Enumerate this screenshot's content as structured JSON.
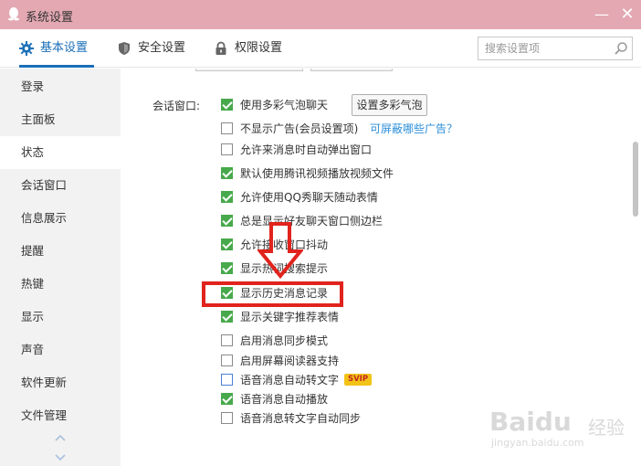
{
  "window": {
    "title": "系统设置",
    "minimize_glyph": "—",
    "close_glyph": "✕"
  },
  "tabs": [
    {
      "label": "基本设置",
      "icon": "gear-icon",
      "active": true
    },
    {
      "label": "安全设置",
      "icon": "shield-icon",
      "active": false
    },
    {
      "label": "权限设置",
      "icon": "lock-icon",
      "active": false
    }
  ],
  "search": {
    "placeholder": "搜索设置项",
    "value": ""
  },
  "sidebar": {
    "items": [
      {
        "label": "登录",
        "active": false
      },
      {
        "label": "主面板",
        "active": false
      },
      {
        "label": "状态",
        "active": true
      },
      {
        "label": "会话窗口",
        "active": false
      },
      {
        "label": "信息展示",
        "active": false
      },
      {
        "label": "提醒",
        "active": false
      },
      {
        "label": "热键",
        "active": false
      },
      {
        "label": "显示",
        "active": false
      },
      {
        "label": "声音",
        "active": false
      },
      {
        "label": "软件更新",
        "active": false
      },
      {
        "label": "文件管理",
        "active": false
      }
    ]
  },
  "main": {
    "section_label": "会话窗口:",
    "bubble_button_label": "设置多彩气泡",
    "ad_link": "可屏蔽哪些广告？",
    "svip_badge": "SVIP",
    "options": [
      {
        "label": "使用多彩气泡聊天",
        "checked": true
      },
      {
        "label": "不显示广告(会员设置项)",
        "checked": false
      },
      {
        "label": "允许来消息时自动弹出窗口",
        "checked": false
      },
      {
        "label": "默认使用腾讯视频播放视频文件",
        "checked": true
      },
      {
        "label": "允许使用QQ秀聊天随动表情",
        "checked": true
      },
      {
        "label": "总是显示好友聊天窗口侧边栏",
        "checked": true
      },
      {
        "label": "允许接收窗口抖动",
        "checked": true
      },
      {
        "label": "显示热词搜索提示",
        "checked": true
      },
      {
        "label": "显示历史消息记录",
        "checked": true
      },
      {
        "label": "显示关键字推荐表情",
        "checked": true
      },
      {
        "label": "启用消息同步模式",
        "checked": false
      },
      {
        "label": "启用屏幕阅读器支持",
        "checked": false
      },
      {
        "label": "语音消息自动转文字",
        "checked": false,
        "blue": true
      },
      {
        "label": "语音消息自动播放",
        "checked": true
      },
      {
        "label": "语音消息转文字自动同步",
        "checked": false
      }
    ]
  },
  "colors": {
    "titlebar": "#e3a8b2",
    "accent": "#1a6fb8",
    "checkbox_checked": "#48a94c",
    "highlight": "#e1231d",
    "link": "#2a8ed8"
  },
  "watermark": {
    "brand": "Baidu",
    "brand_cn": "经验",
    "url": "jingyan.baidu.com"
  }
}
